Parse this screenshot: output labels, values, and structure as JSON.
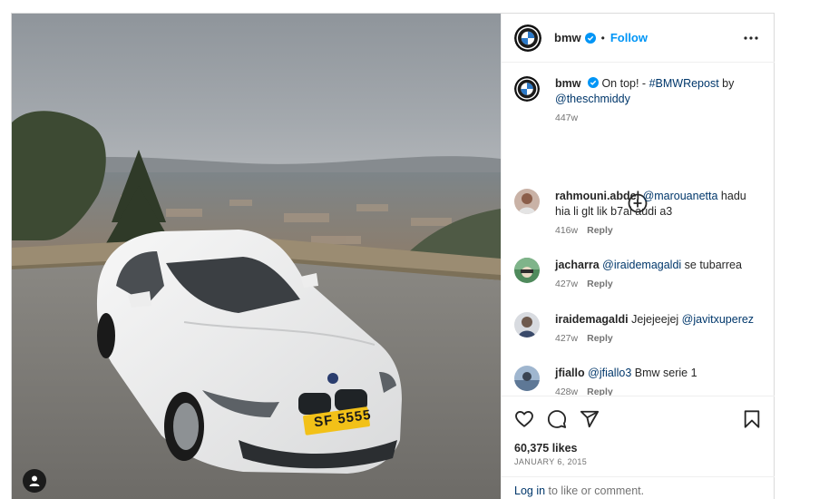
{
  "post": {
    "username": "bmw",
    "follow_label": "Follow",
    "dot": "•",
    "caption": {
      "username": "bmw",
      "text_before": "On top! - ",
      "hashtag": "#BMWRepost",
      "text_mid": " by",
      "mention": "@theschmiddy",
      "time": "447w"
    },
    "plate_text": "SF 5555"
  },
  "comments": [
    {
      "username": "rahmouni.abdel",
      "mention": "@marouanetta",
      "text": " hadu hia li glt lik b7al audi a3",
      "time": "416w",
      "reply_label": "Reply"
    },
    {
      "username": "jacharra",
      "mention": "@iraidemagaldi",
      "text": " se tubarrea",
      "time": "427w",
      "reply_label": "Reply"
    },
    {
      "username": "iraidemagaldi",
      "text_before": "Jejejeejej ",
      "mention": "@javitxuperez",
      "time": "427w",
      "reply_label": "Reply"
    },
    {
      "username": "jfiallo",
      "mention": "@jfiallo3",
      "text": " Bmw serie 1",
      "time": "428w",
      "reply_label": "Reply"
    }
  ],
  "actions": {
    "likes": "60,375 likes",
    "date": "JANUARY 6, 2015",
    "login_link": "Log in",
    "login_rest": " to like or comment."
  },
  "icons": {
    "like": "heart-icon",
    "comment": "comment-icon",
    "share": "share-icon",
    "save": "bookmark-icon",
    "more": "more-options-icon",
    "load_more": "plus-circle-icon",
    "user_tags": "user-tag-icon"
  },
  "colors": {
    "accent": "#0095f6",
    "mention": "#00376b",
    "verified": "#0095f6"
  }
}
